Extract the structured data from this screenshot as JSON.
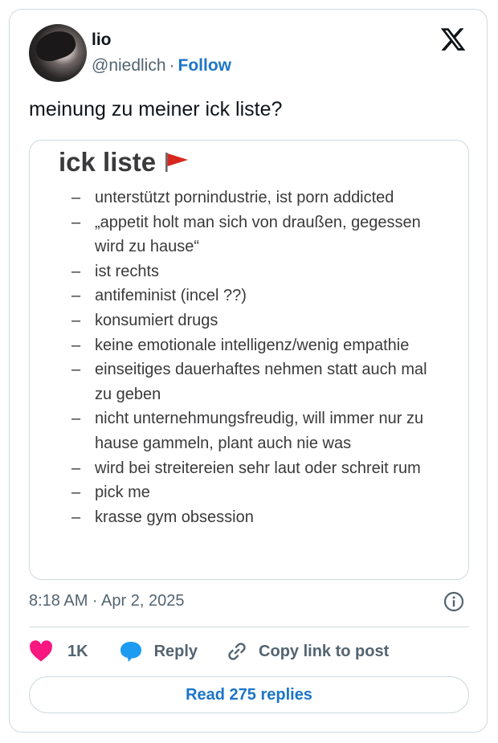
{
  "author": {
    "name": "lio",
    "handle": "@niedlich",
    "separator": "·",
    "follow_label": "Follow"
  },
  "icons": {
    "logo": "x-logo-icon",
    "info": "info-icon",
    "like": "heart-icon",
    "reply": "reply-bubble-icon",
    "copy": "link-icon",
    "flag": "red-flag-emoji"
  },
  "colors": {
    "accent": "#1d75c9",
    "like": "#f91880",
    "reply": "#1d9bf0",
    "muted": "#536471"
  },
  "tweet": {
    "text": "meinung zu meiner ick liste?",
    "timestamp": "8:18 AM · Apr 2, 2025"
  },
  "media": {
    "title": "ick liste",
    "flag": "🚩",
    "dash": "–",
    "items": [
      "unterstützt pornindustrie, ist porn addicted",
      "„appetit holt man sich von draußen, gegessen wird zu hause“",
      "ist rechts",
      "antifeminist (incel ??)",
      "konsumiert drugs",
      "keine emotionale intelligenz/wenig empathie",
      "einseitiges dauerhaftes nehmen statt auch mal zu geben",
      "nicht unternehmungsfreudig, will immer nur zu hause gammeln, plant auch nie was",
      "wird bei streitereien sehr laut oder schreit rum",
      "pick me",
      "krasse gym obsession"
    ]
  },
  "actions": {
    "like_count": "1K",
    "reply_label": "Reply",
    "copy_label": "Copy link to post"
  },
  "read_replies_label": "Read 275 replies"
}
